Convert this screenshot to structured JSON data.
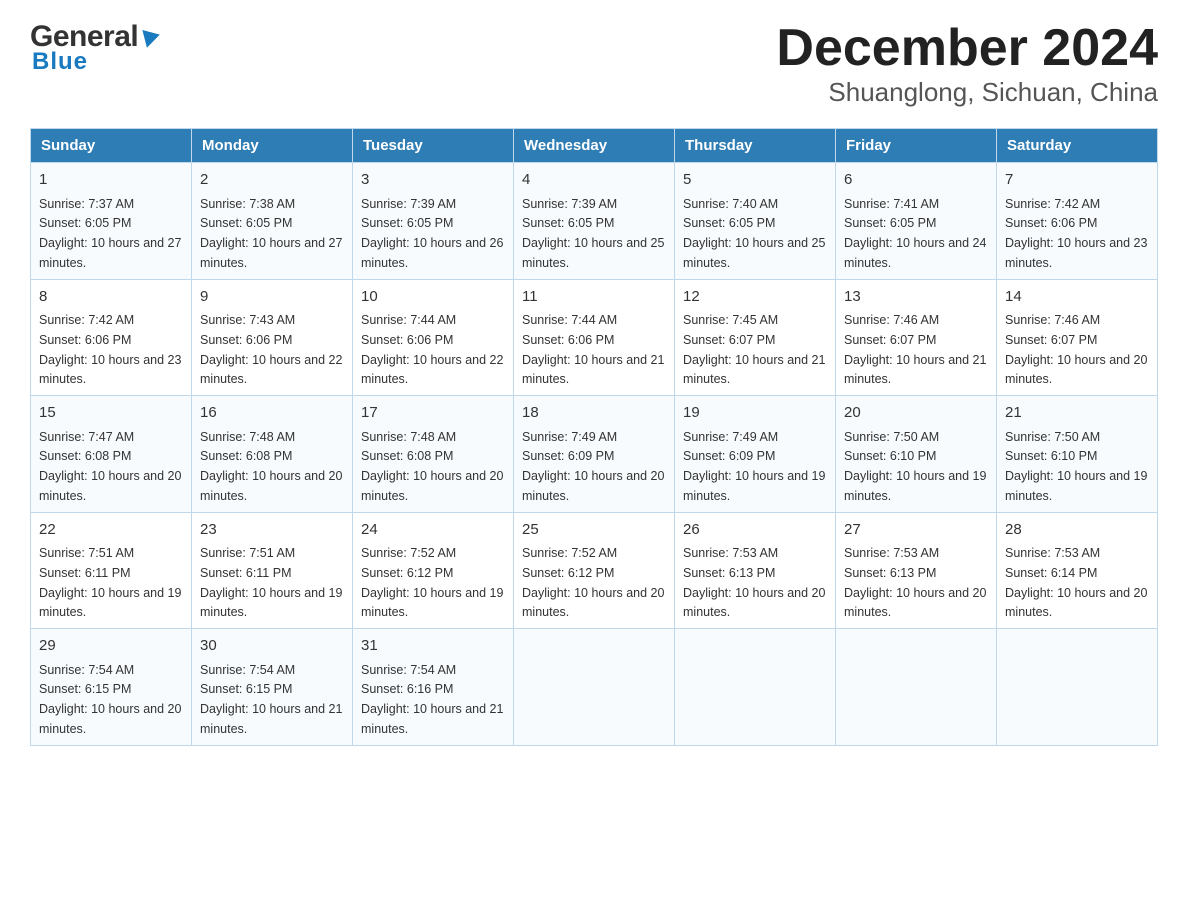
{
  "header": {
    "logo_general": "General",
    "logo_blue": "Blue",
    "title": "December 2024",
    "subtitle": "Shuanglong, Sichuan, China"
  },
  "calendar": {
    "headers": [
      "Sunday",
      "Monday",
      "Tuesday",
      "Wednesday",
      "Thursday",
      "Friday",
      "Saturday"
    ],
    "weeks": [
      [
        {
          "day": "1",
          "sunrise": "7:37 AM",
          "sunset": "6:05 PM",
          "daylight": "10 hours and 27 minutes."
        },
        {
          "day": "2",
          "sunrise": "7:38 AM",
          "sunset": "6:05 PM",
          "daylight": "10 hours and 27 minutes."
        },
        {
          "day": "3",
          "sunrise": "7:39 AM",
          "sunset": "6:05 PM",
          "daylight": "10 hours and 26 minutes."
        },
        {
          "day": "4",
          "sunrise": "7:39 AM",
          "sunset": "6:05 PM",
          "daylight": "10 hours and 25 minutes."
        },
        {
          "day": "5",
          "sunrise": "7:40 AM",
          "sunset": "6:05 PM",
          "daylight": "10 hours and 25 minutes."
        },
        {
          "day": "6",
          "sunrise": "7:41 AM",
          "sunset": "6:05 PM",
          "daylight": "10 hours and 24 minutes."
        },
        {
          "day": "7",
          "sunrise": "7:42 AM",
          "sunset": "6:06 PM",
          "daylight": "10 hours and 23 minutes."
        }
      ],
      [
        {
          "day": "8",
          "sunrise": "7:42 AM",
          "sunset": "6:06 PM",
          "daylight": "10 hours and 23 minutes."
        },
        {
          "day": "9",
          "sunrise": "7:43 AM",
          "sunset": "6:06 PM",
          "daylight": "10 hours and 22 minutes."
        },
        {
          "day": "10",
          "sunrise": "7:44 AM",
          "sunset": "6:06 PM",
          "daylight": "10 hours and 22 minutes."
        },
        {
          "day": "11",
          "sunrise": "7:44 AM",
          "sunset": "6:06 PM",
          "daylight": "10 hours and 21 minutes."
        },
        {
          "day": "12",
          "sunrise": "7:45 AM",
          "sunset": "6:07 PM",
          "daylight": "10 hours and 21 minutes."
        },
        {
          "day": "13",
          "sunrise": "7:46 AM",
          "sunset": "6:07 PM",
          "daylight": "10 hours and 21 minutes."
        },
        {
          "day": "14",
          "sunrise": "7:46 AM",
          "sunset": "6:07 PM",
          "daylight": "10 hours and 20 minutes."
        }
      ],
      [
        {
          "day": "15",
          "sunrise": "7:47 AM",
          "sunset": "6:08 PM",
          "daylight": "10 hours and 20 minutes."
        },
        {
          "day": "16",
          "sunrise": "7:48 AM",
          "sunset": "6:08 PM",
          "daylight": "10 hours and 20 minutes."
        },
        {
          "day": "17",
          "sunrise": "7:48 AM",
          "sunset": "6:08 PM",
          "daylight": "10 hours and 20 minutes."
        },
        {
          "day": "18",
          "sunrise": "7:49 AM",
          "sunset": "6:09 PM",
          "daylight": "10 hours and 20 minutes."
        },
        {
          "day": "19",
          "sunrise": "7:49 AM",
          "sunset": "6:09 PM",
          "daylight": "10 hours and 19 minutes."
        },
        {
          "day": "20",
          "sunrise": "7:50 AM",
          "sunset": "6:10 PM",
          "daylight": "10 hours and 19 minutes."
        },
        {
          "day": "21",
          "sunrise": "7:50 AM",
          "sunset": "6:10 PM",
          "daylight": "10 hours and 19 minutes."
        }
      ],
      [
        {
          "day": "22",
          "sunrise": "7:51 AM",
          "sunset": "6:11 PM",
          "daylight": "10 hours and 19 minutes."
        },
        {
          "day": "23",
          "sunrise": "7:51 AM",
          "sunset": "6:11 PM",
          "daylight": "10 hours and 19 minutes."
        },
        {
          "day": "24",
          "sunrise": "7:52 AM",
          "sunset": "6:12 PM",
          "daylight": "10 hours and 19 minutes."
        },
        {
          "day": "25",
          "sunrise": "7:52 AM",
          "sunset": "6:12 PM",
          "daylight": "10 hours and 20 minutes."
        },
        {
          "day": "26",
          "sunrise": "7:53 AM",
          "sunset": "6:13 PM",
          "daylight": "10 hours and 20 minutes."
        },
        {
          "day": "27",
          "sunrise": "7:53 AM",
          "sunset": "6:13 PM",
          "daylight": "10 hours and 20 minutes."
        },
        {
          "day": "28",
          "sunrise": "7:53 AM",
          "sunset": "6:14 PM",
          "daylight": "10 hours and 20 minutes."
        }
      ],
      [
        {
          "day": "29",
          "sunrise": "7:54 AM",
          "sunset": "6:15 PM",
          "daylight": "10 hours and 20 minutes."
        },
        {
          "day": "30",
          "sunrise": "7:54 AM",
          "sunset": "6:15 PM",
          "daylight": "10 hours and 21 minutes."
        },
        {
          "day": "31",
          "sunrise": "7:54 AM",
          "sunset": "6:16 PM",
          "daylight": "10 hours and 21 minutes."
        },
        null,
        null,
        null,
        null
      ]
    ]
  }
}
